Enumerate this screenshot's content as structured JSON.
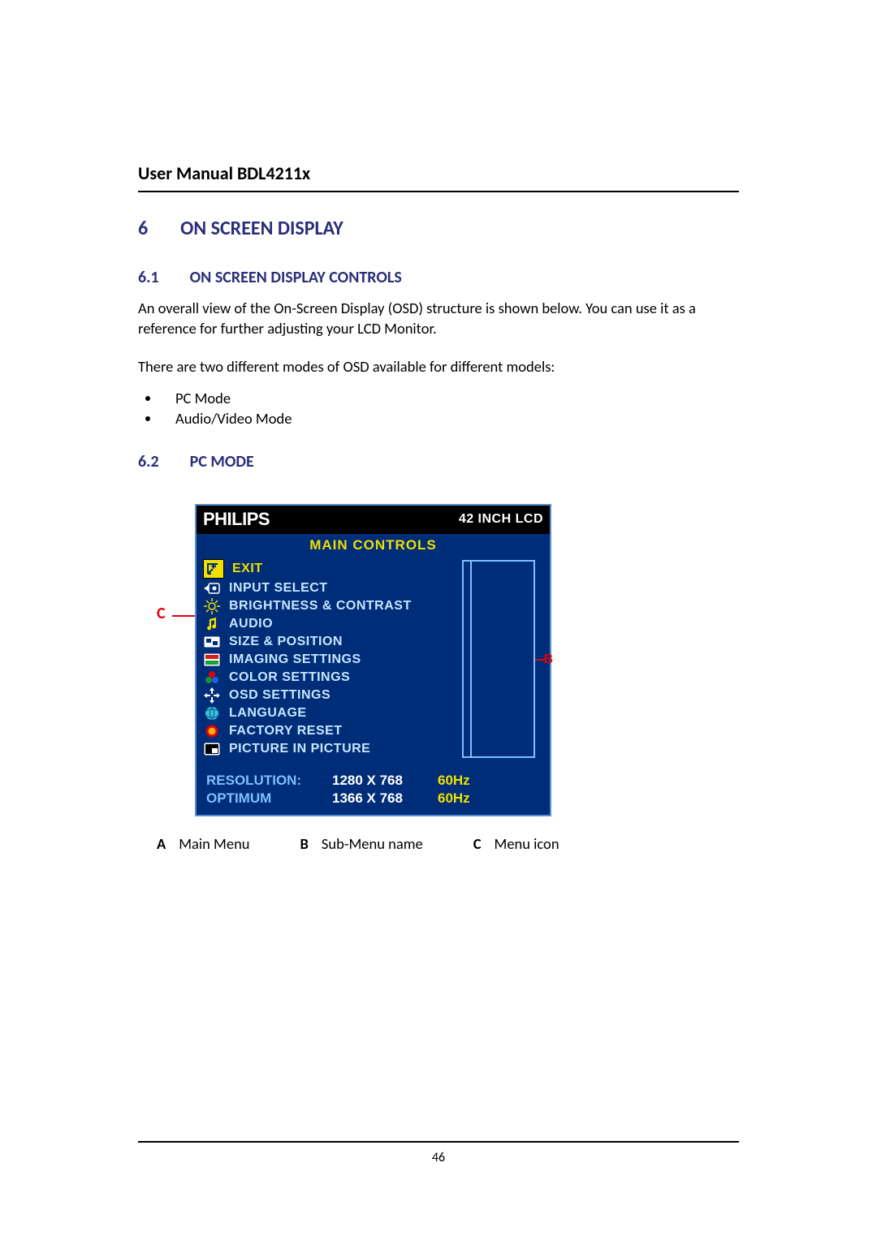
{
  "header": {
    "title": "User Manual BDL4211x"
  },
  "section": {
    "num": "6",
    "title": "ON SCREEN DISPLAY"
  },
  "sub61": {
    "num": "6.1",
    "title": "ON SCREEN DISPLAY CONTROLS",
    "para1": "An overall view of the On-Screen Display (OSD) structure is shown below. You can use it as a reference for further adjusting your LCD Monitor.",
    "para2": "There are two different modes of OSD available for different models:",
    "modes": [
      "PC Mode",
      "Audio/Video Mode"
    ]
  },
  "sub62": {
    "num": "6.2",
    "title": "PC MODE"
  },
  "labels": {
    "A": "A",
    "B": "B",
    "C": "C"
  },
  "osd": {
    "brand": "PHILIPS",
    "model": "42 INCH LCD",
    "main_controls": "MAIN CONTROLS",
    "items": [
      {
        "id": "exit",
        "label": "EXIT",
        "icon": "exit-icon",
        "selected": true
      },
      {
        "id": "input-select",
        "label": "INPUT SELECT",
        "icon": "input-icon"
      },
      {
        "id": "brightness-contrast",
        "label": "BRIGHTNESS & CONTRAST",
        "icon": "sun-icon"
      },
      {
        "id": "audio",
        "label": "AUDIO",
        "icon": "note-icon"
      },
      {
        "id": "size-position",
        "label": "SIZE & POSITION",
        "icon": "size-icon"
      },
      {
        "id": "imaging-settings",
        "label": "IMAGING SETTINGS",
        "icon": "image-icon"
      },
      {
        "id": "color-settings",
        "label": "COLOR SETTINGS",
        "icon": "rgb-icon"
      },
      {
        "id": "osd-settings",
        "label": "OSD SETTINGS",
        "icon": "cross-arrows-icon"
      },
      {
        "id": "language",
        "label": "LANGUAGE",
        "icon": "globe-icon"
      },
      {
        "id": "factory-reset",
        "label": "FACTORY RESET",
        "icon": "reset-icon"
      },
      {
        "id": "pip",
        "label": "PICTURE IN PICTURE",
        "icon": "pip-icon"
      }
    ],
    "bottom": {
      "resolution_label": "RESOLUTION:",
      "resolution_value": "1280 X 768",
      "resolution_hz": "60Hz",
      "optimum_label": "OPTIMUM",
      "optimum_value": "1366 X 768",
      "optimum_hz": "60Hz"
    }
  },
  "legend": {
    "A": "Main Menu",
    "B": "Sub-Menu name",
    "C": "Menu icon"
  },
  "page_number": "46"
}
